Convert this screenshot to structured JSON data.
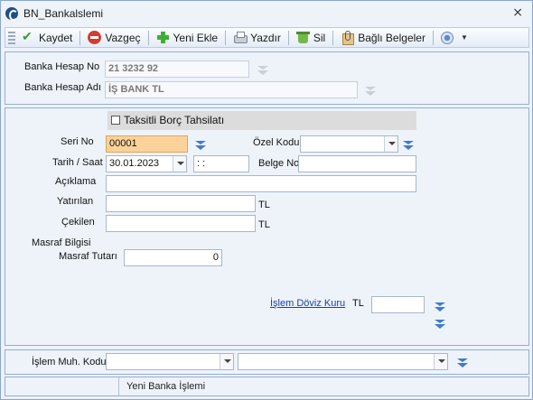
{
  "window": {
    "title": "BN_Bankalslemi",
    "close_glyph": "⨯"
  },
  "toolbar": {
    "buttons": [
      {
        "label": "Kaydet",
        "icon": "check-icon"
      },
      {
        "label": "Vazgeç",
        "icon": "cancel-icon"
      },
      {
        "label": "Yeni Ekle",
        "icon": "plus-icon"
      },
      {
        "label": "Yazdır",
        "icon": "printer-icon"
      },
      {
        "label": "Sil",
        "icon": "delete-icon"
      },
      {
        "label": "Bağlı Belgeler",
        "icon": "attachment-icon"
      }
    ]
  },
  "bank": {
    "account_no_label": "Banka Hesap No",
    "account_no_value": "21 3232 92",
    "account_name_label": "Banka Hesap Adı",
    "account_name_value": "İŞ BANK TL"
  },
  "group": {
    "title": "Taksitli Borç Tahsilatı",
    "checked": false
  },
  "form": {
    "seri_no_label": "Seri No",
    "seri_no_value": "00001",
    "ozel_kodu_label": "Özel Kodu",
    "ozel_kodu_value": "",
    "tarih_saat_label": "Tarih / Saat",
    "tarih_value": "30.01.2023",
    "saat_value": " :  :",
    "belge_no_label": "Belge No",
    "belge_no_value": "",
    "aciklama_label": "Açıklama",
    "aciklama_value": "",
    "yatirilan_label": "Yatırılan",
    "yatirilan_value": "",
    "yatirilan_currency": "TL",
    "cekilen_label": "Çekilen",
    "cekilen_value": "",
    "cekilen_currency": "TL",
    "masraf_bilgisi_label": "Masraf Bilgisi",
    "masraf_tutari_label": "Masraf Tutarı",
    "masraf_tutari_value": "0",
    "doviz_kuru_link": "İşlem Döviz Kuru",
    "doviz_currency": "TL",
    "doviz_value": ""
  },
  "bottom": {
    "muh_kodu_label": "İşlem Muh. Kodu",
    "muh_kodu_value": "",
    "muh_kodu_name_value": ""
  },
  "footer": {
    "tab_label": "Yeni Banka İşlemi"
  }
}
